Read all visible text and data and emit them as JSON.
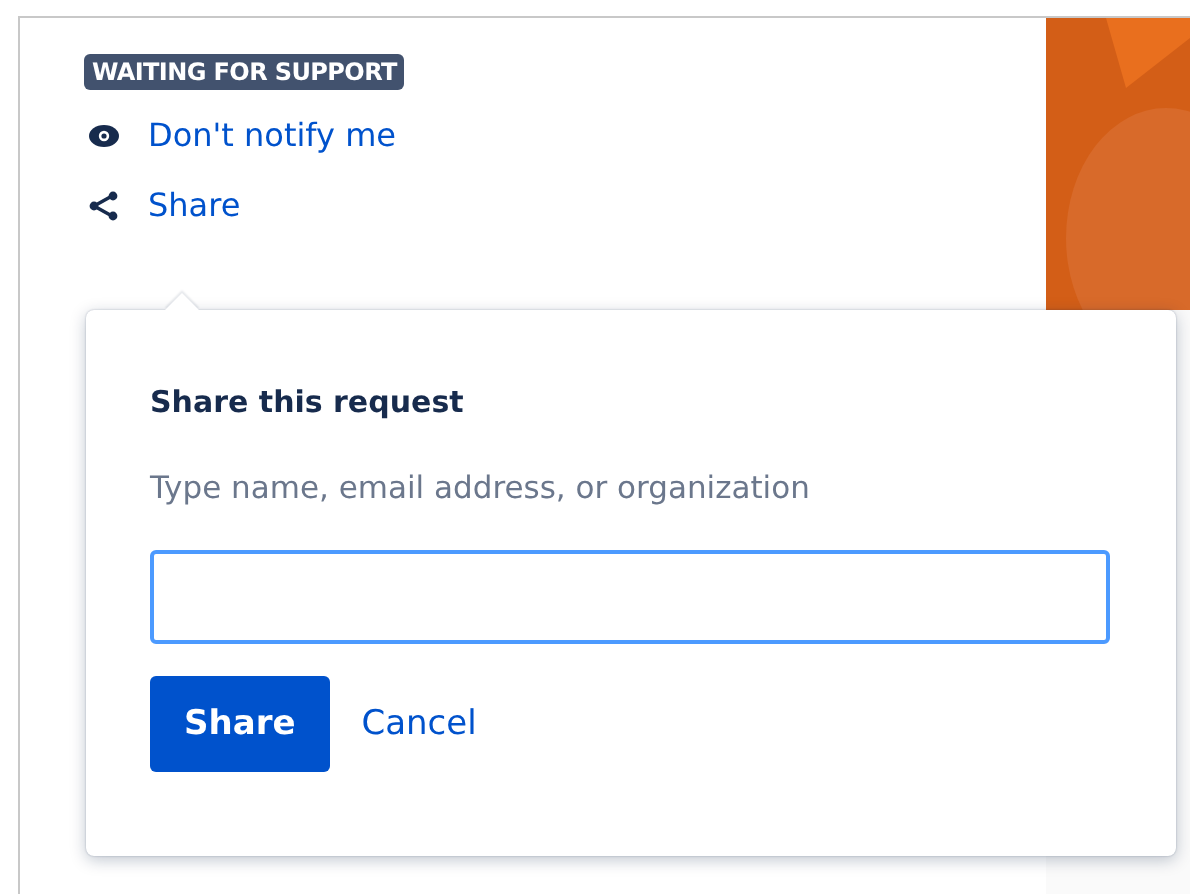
{
  "status_lozenge": "WAITING FOR SUPPORT",
  "actions": [
    {
      "kind": "watch",
      "label": "Don't notify me"
    },
    {
      "kind": "share",
      "label": "Share"
    }
  ],
  "share_popup": {
    "title": "Share this request",
    "field_label": "Type name, email address, or organization",
    "buttons": [
      {
        "kind": "primary",
        "label": "Share"
      },
      {
        "kind": "link",
        "label": "Cancel"
      }
    ]
  }
}
